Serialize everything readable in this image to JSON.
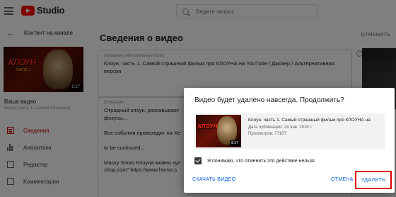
{
  "app": {
    "name": "Studio"
  },
  "search": {
    "placeholder": "Ведите запрос"
  },
  "sidebar": {
    "header": "Контент на канале",
    "video_label": "Ваше видео",
    "video_subtitle": "Клоун, часть 1. Самый страшный",
    "thumb_text": "КЛОУН",
    "thumb_subtext": "ЧАСТЬ 1",
    "duration": "8:27",
    "items": [
      {
        "label": "Сведения",
        "icon": "details-icon",
        "active": true
      },
      {
        "label": "Аналитика",
        "icon": "analytics-icon",
        "active": false
      },
      {
        "label": "Редактор",
        "icon": "editor-icon",
        "active": false
      },
      {
        "label": "Комментарии",
        "icon": "comments-icon",
        "active": false
      }
    ]
  },
  "main": {
    "title": "Сведения о видео",
    "cancel_changes": "ОТМЕНИТЬ",
    "title_field": {
      "label": "Название (обязательное поле)",
      "value": "Клоун, часть 1. Самый страшный фильм про КЛОУНА на YouTube / Джокер / Альтернативная версия"
    },
    "description_field": {
      "label": "Описание",
      "lines": [
        "Отрадный клоун, раскавывает",
        "фокусы...",
        "",
        "Все события происходят на Хе",
        "",
        "to be continued...",
        "",
        "Маску Злого Клоуна можно куп",
        "shop.com\" https://www.horror.s"
      ]
    }
  },
  "dialog": {
    "title": "Видео будет удалено навсегда. Продолжить?",
    "card": {
      "title": "Клоун. часть 1. Самый страшный фильм про КЛОУНА на",
      "date": "Дата публикации: 24 янв. 2019 г.",
      "views": "Просмотров: 77107",
      "duration": "8:27",
      "thumb_text": "КЛОУН"
    },
    "confirm_label": "Я понимаю, что отменить это действие нельзя",
    "confirm_checked": true,
    "download_button": "СКАЧАТЬ ВИДЕО",
    "cancel_button": "ОТМЕНА",
    "delete_button": "УДАЛИТЬ"
  },
  "colors": {
    "brand_red": "#ff0000",
    "active_nav": "#cc0000",
    "link_blue": "#065fd4",
    "highlight_border": "#e00000"
  }
}
